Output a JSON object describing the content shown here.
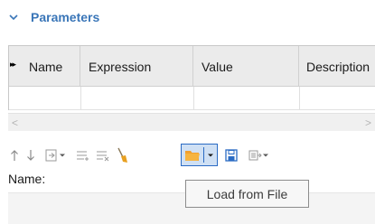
{
  "section": {
    "title": "Parameters",
    "expanded_icon": "chevron-down-icon"
  },
  "table": {
    "columns": [
      "Name",
      "Expression",
      "Value",
      "Description"
    ],
    "row_marker": "▸▸"
  },
  "toolbar": {
    "buttons": [
      {
        "name": "move-up-button",
        "icon": "arrow-up-icon"
      },
      {
        "name": "move-down-button",
        "icon": "arrow-down-icon"
      },
      {
        "name": "insert-button",
        "icon": "insert-icon"
      },
      {
        "name": "add-row-button",
        "icon": "add-row-icon"
      },
      {
        "name": "delete-row-button",
        "icon": "delete-row-icon"
      },
      {
        "name": "clear-button",
        "icon": "broom-icon"
      },
      {
        "name": "load-from-file-button",
        "icon": "folder-icon"
      },
      {
        "name": "save-to-file-button",
        "icon": "save-icon"
      },
      {
        "name": "export-button",
        "icon": "export-icon"
      }
    ]
  },
  "name_label": "Name:",
  "tooltip": "Load from File"
}
